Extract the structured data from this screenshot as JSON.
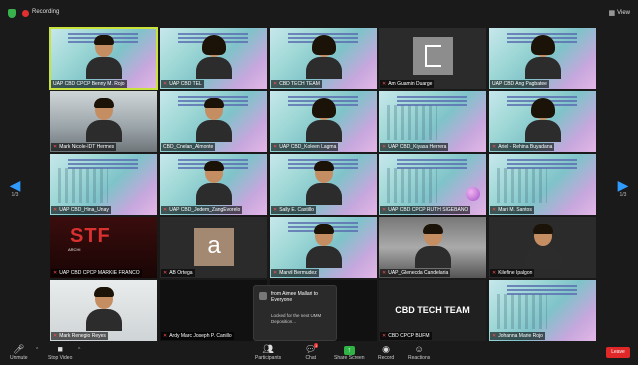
{
  "topbar": {
    "recording_label": "Recording",
    "view_label": "View"
  },
  "pager": {
    "left_page": "1/3",
    "right_page": "1/3"
  },
  "tiles": [
    "UAP CBD CPCP Benny M. Rojo",
    "UAP CBD TEL",
    "CBD TECH TEAM",
    "Am Guamin Duarge",
    "UAP CBD Ang Pagbatee",
    "Mark Nicole-IDT Hermes",
    "CBD_Cnelan_Almonte",
    "UAP CBD_Koleen Lagma",
    "UAP CBD_Kiyasa Herrera",
    "Ariel - Rehina Buyadana",
    "UAP CBD_Hina_Unay",
    "UAP CBD_Jedem_ZangEvorelo",
    "Sally E. Castillo",
    "UAP CBD CPCP RUTH SIGEBANO",
    "Mari M. Santos",
    "UAP CBD CPCP MARKIE FRANCO",
    "AB Ortega",
    "Marvil Bermudez",
    "UAP_Glenecda Candelaria",
    "Kilefine Ipalgon",
    "Mark Renegio Reyes",
    "Ardy Marc Joseph P. Canillo",
    "",
    "CBD CPCP BUFM",
    "Johanna Marie Rojo"
  ],
  "stf": {
    "logo": "STF",
    "sub": "ARCHI"
  },
  "avatar_letter": "a",
  "cbd_banner": "CBD TECH TEAM",
  "chat": {
    "header": "from Aimee Mallari to Everyone",
    "message": "Locked for the next UMM Deposition..."
  },
  "toolbar": {
    "unmute": "Unmute",
    "stop_video": "Stop Video",
    "participants": "Participants",
    "participants_count": "41",
    "chat": "Chat",
    "chat_badge": "1",
    "share_screen": "Share Screen",
    "record": "Record",
    "reactions": "Reactions",
    "leave": "Leave"
  }
}
